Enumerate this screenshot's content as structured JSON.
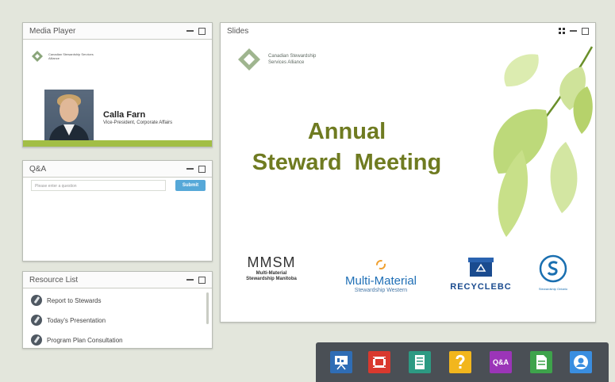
{
  "media_player": {
    "title": "Media Player",
    "org_name": "Canadian Stewardship Services Alliance",
    "speaker_name": "Calla Farn",
    "speaker_title": "Vice-President, Corporate Affairs"
  },
  "qa": {
    "title": "Q&A",
    "placeholder": "Please enter a question",
    "submit_label": "Submit"
  },
  "resources": {
    "title": "Resource List",
    "items": [
      "Report to Stewards",
      "Today's Presentation",
      "Program Plan Consultation"
    ]
  },
  "slides": {
    "title": "Slides",
    "org_line1": "Canadian Stewardship",
    "org_line2": "Services Alliance",
    "heading_line1": "Annual",
    "heading_line2": "Steward  Meeting",
    "sponsors": {
      "mmsm_big": "MMSM",
      "mmsm_sub1": "Multi-Material",
      "mmsm_sub2": "Stewardship Manitoba",
      "mmw_big": "Multi-Material",
      "mmw_sub": "Stewardship Western",
      "rbc_name": "RECYCLEBC",
      "so_name": "Stewardship Ontario"
    }
  },
  "toolbar": {
    "buttons": [
      {
        "icon": "presentation-icon",
        "color": "#2f6db5"
      },
      {
        "icon": "video-icon",
        "color": "#d9392e"
      },
      {
        "icon": "notes-icon",
        "color": "#2d9a83"
      },
      {
        "icon": "help-icon",
        "color": "#f2b61d"
      },
      {
        "icon": "qa-icon",
        "color": "#9b35b8",
        "label": "Q&A"
      },
      {
        "icon": "document-icon",
        "color": "#3ea34b"
      },
      {
        "icon": "profile-icon",
        "color": "#3a8ee0"
      }
    ]
  },
  "colors": {
    "accent_green": "#a2be45",
    "title_olive": "#6f7b21",
    "submit_blue": "#56a8d8"
  }
}
